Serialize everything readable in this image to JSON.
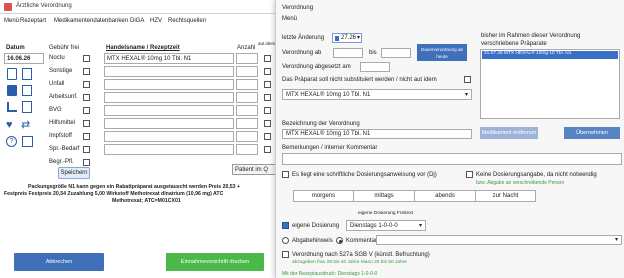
{
  "left": {
    "window_title": "Ärztliche Verordnung",
    "tabs": [
      "Menü",
      "Rezeptart",
      "Medikamentendatenbanken",
      "DiGA",
      "HZV",
      "Rechtsquellen"
    ],
    "date_header": "Datum",
    "date_value": "16.06.26",
    "category_header": "Gebühr frei",
    "categories": [
      "Noctu",
      "Sonstige",
      "Unfall",
      "Arbeitsunf.",
      "BVG",
      "Hilfsmittel",
      "Impfstoff",
      "Spr.-Bedarf",
      "Begr.-Pfl."
    ],
    "col_name": "Handelsname / Rezeptzeit",
    "col_amount": "Anzahl",
    "col_ave": "aut idem",
    "med_line": "MTX HEXAL® 10mg 10 Tbl. N1",
    "patient_btn": "Patient im Q",
    "save_btn": "Speichern",
    "info_line1": "Packungsgröße N1  kann gegen ein Rabattpräparat ausgetauscht werden   Preis 20,53  +",
    "info_line2": "Festpreis  Festpreis 20,54   Zuzahlung 5,00   Wirkstoff Methotrexat dinatrium (10,96 mg)   ATC",
    "info_line3": "Methotrexat; ATC=M01CX01",
    "cancel_btn": "Abbrechen",
    "print_btn": "Einnahmevorschrift drucken"
  },
  "right": {
    "title": "Verordnung",
    "menu": "Menü",
    "last_change_label": "letzte Änderung",
    "last_change_value": "27.26",
    "prescription_from_label": "Verordnung ab",
    "to_label": "bis",
    "prescription_until_btn": "Dauerverordnung ab heute",
    "discontinued_label": "Verordnung abgesetzt am",
    "aut_idem_text": "Das Präparat soll nicht substituiert werden / nicht aut idem",
    "med_select": "MTX HEXAL® 10mg 10 Tbl. N1",
    "bez_label": "Bezeichnung der Verordnung",
    "bez_value": "MTX HEXAL® 10mg 10 Tbl. N1",
    "bemerkung_label": "Bemerkungen / interner Kommentar",
    "prev_title_1": "bisher im Rahmen dieser Verordnung",
    "prev_title_2": "verschriebene Präparate",
    "prev_item": "21.07.26    MTX HEXAL® 10mg 10 Tbl. N1",
    "remove_btn": "Medikament entfernen",
    "take_btn": "Übernehmen",
    "schriftlich_label": "Es liegt eine schriftliche Dosierungsanweisung vor (Dj)",
    "keine_label": "Keine Dosierungsangabe, da nicht notwendig",
    "keine_sub": "bzw. Abgabe an verschreibende Person",
    "times": [
      "morgens",
      "mittags",
      "abends",
      "zur Nacht"
    ],
    "eigene_header": "eigene Dosierung Freitext",
    "eigene_label": "eigene Dosierung",
    "eigene_value": "Dienstags 1-0-0-0",
    "abgabe_label": "Abgabehinweis",
    "kommentar_label": "Kommentar",
    "verordnung_527": "Verordnung nach 527a SGB V (künstl. Befruchtung)",
    "verordnung_527_sub": "abzugeben frau  28  bis 40 Jahre    Mann  25 bis 50 Jahre",
    "footer_text": "Mit der Rezeptausdruck: Dienstags 1-0-0-0"
  }
}
